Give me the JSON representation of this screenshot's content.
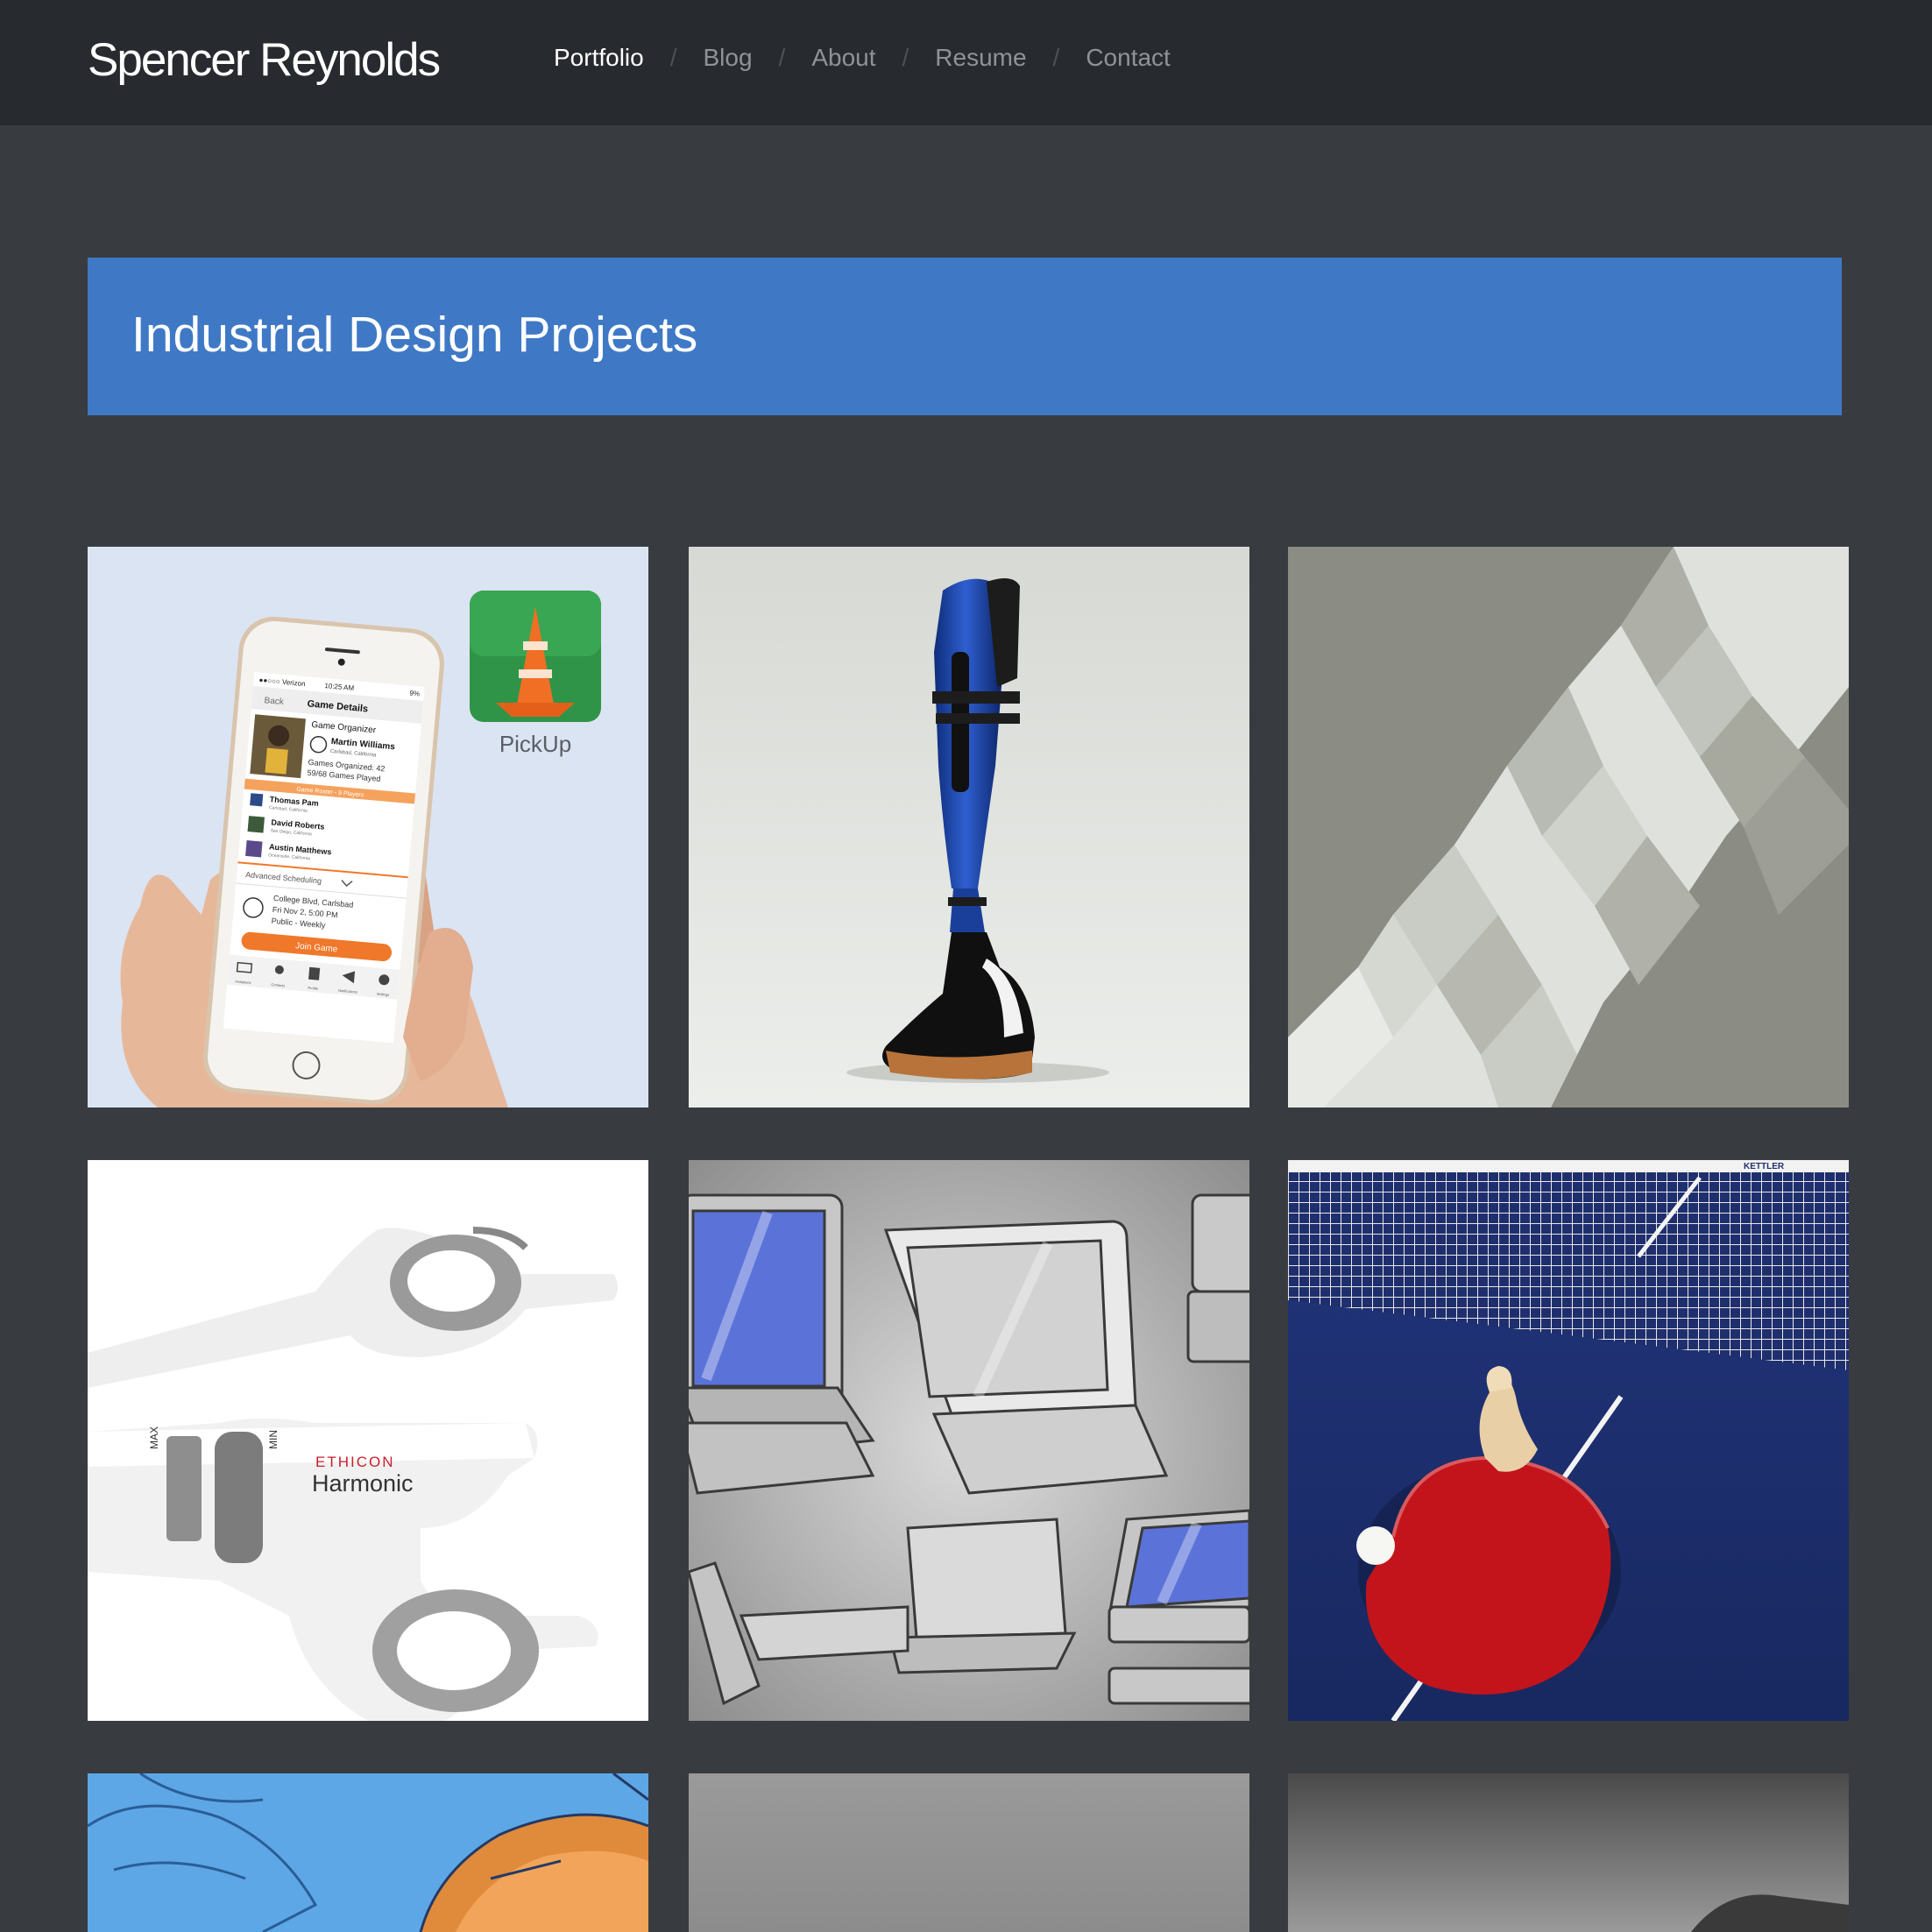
{
  "header": {
    "site_title": "Spencer Reynolds",
    "nav": [
      {
        "label": "Portfolio",
        "active": true
      },
      {
        "label": "Blog",
        "active": false
      },
      {
        "label": "About",
        "active": false
      },
      {
        "label": "Resume",
        "active": false
      },
      {
        "label": "Contact",
        "active": false
      }
    ],
    "separator": "/"
  },
  "banner": {
    "title": "Industrial Design Projects"
  },
  "projects": [
    {
      "subject": "pickup-app-phone",
      "app_label": "PickUp",
      "phone": {
        "carrier": "●●○○○ Verizon",
        "time": "10:25 AM",
        "battery": "9%",
        "back": "Back",
        "screen_title": "Game Details",
        "organizer_heading": "Game Organizer",
        "organizer_name": "Martin Williams",
        "organizer_location": "Carlsbad, California",
        "stat_organized": "Games Organized: 42",
        "stat_played": "59/68 Games Played",
        "roster_label": "Game Roster - 9 Players",
        "roster": [
          {
            "name": "Thomas Pam",
            "location": "Carlsbad, California"
          },
          {
            "name": "David Roberts",
            "location": "San Diego, California"
          },
          {
            "name": "Austin Matthews",
            "location": "Oceanside, California"
          }
        ],
        "advanced": "Advanced Scheduling",
        "address": "College Blvd, Carlsbad",
        "date": "Fri Nov 2, 5:00 PM",
        "visibility": "Public - Weekly",
        "join": "Join Game",
        "tabs": [
          "Invitations",
          "Contacts",
          "Profile",
          "Notifications",
          "Settings"
        ]
      }
    },
    {
      "subject": "prosthetic-leg-cover"
    },
    {
      "subject": "faceted-surface"
    },
    {
      "subject": "harmonic-surgical-device",
      "brand": "ETHICON",
      "product": "Harmonic",
      "mark_max": "MAX",
      "mark_min": "MIN"
    },
    {
      "subject": "tablet-case-sketches"
    },
    {
      "subject": "ping-pong-paddle",
      "net_brand": "KETTLER"
    },
    {
      "subject": "vehicle-concept-sketch"
    },
    {
      "subject": "grey-project"
    },
    {
      "subject": "dark-project"
    }
  ],
  "colors": {
    "topbar": "#272a2e",
    "page": "#383b40",
    "banner": "#3f79c6",
    "nav_active": "#ffffff",
    "nav_inactive": "#8f9398",
    "accent_orange": "#f0782a"
  }
}
